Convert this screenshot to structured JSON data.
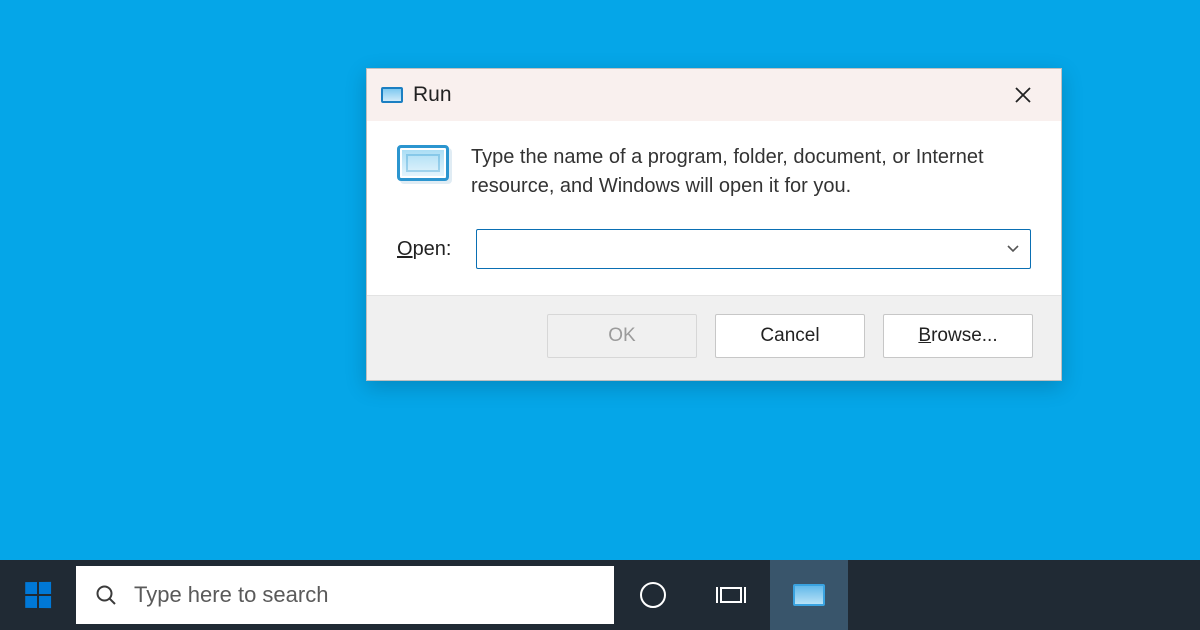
{
  "dialog": {
    "title": "Run",
    "description": "Type the name of a program, folder, document, or Internet resource, and Windows will open it for you.",
    "open_label_pre": "O",
    "open_label_post": "pen:",
    "input_value": "",
    "buttons": {
      "ok": "OK",
      "cancel": "Cancel",
      "browse_pre": "B",
      "browse_post": "rowse..."
    }
  },
  "taskbar": {
    "search_placeholder": "Type here to search"
  }
}
